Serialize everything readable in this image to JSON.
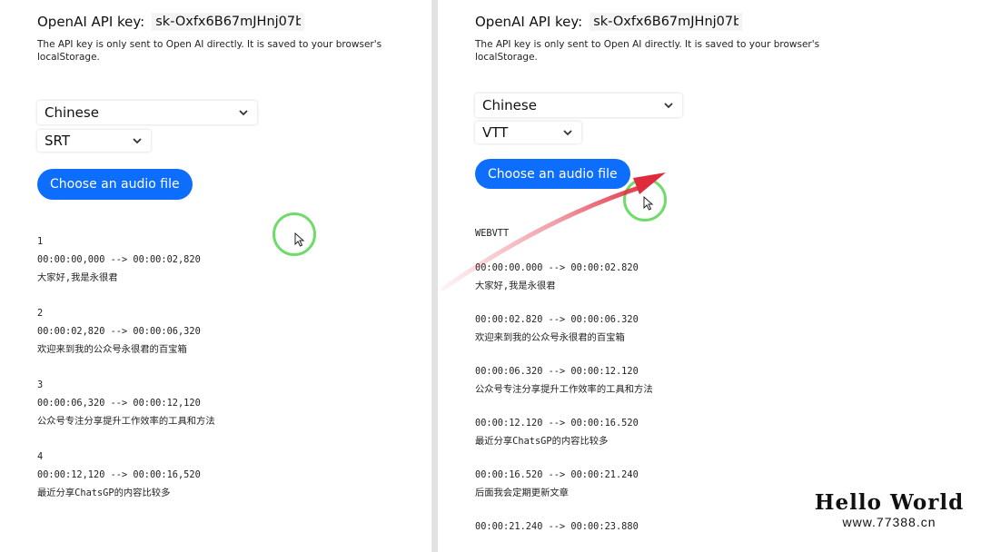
{
  "left": {
    "api_key_label": "OpenAI API key:",
    "api_key_value": "sk-Oxfx6B67mJHnj07bl",
    "notice": "The API key is only sent to Open AI directly. It is saved to your browser's localStorage.",
    "language_select": "Chinese",
    "format_select": "SRT",
    "choose_button": "Choose an audio file",
    "output": [
      {
        "index": "1",
        "timing": "00:00:00,000 --> 00:00:02,820",
        "text": "大家好,我是永很君"
      },
      {
        "index": "2",
        "timing": "00:00:02,820 --> 00:00:06,320",
        "text": "欢迎来到我的公众号永很君的百宝箱"
      },
      {
        "index": "3",
        "timing": "00:00:06,320 --> 00:00:12,120",
        "text": "公众号专注分享提升工作效率的工具和方法"
      },
      {
        "index": "4",
        "timing": "00:00:12,120 --> 00:00:16,520",
        "text": "最近分享ChatsGP的内容比较多"
      }
    ]
  },
  "right": {
    "api_key_label": "OpenAI API key:",
    "api_key_value": "sk-Oxfx6B67mJHnj07bl",
    "notice": "The API key is only sent to Open AI directly. It is saved to your browser's localStorage.",
    "language_select": "Chinese",
    "format_select": "VTT",
    "choose_button": "Choose an audio file",
    "output_header": "WEBVTT",
    "output": [
      {
        "timing": "00:00:00.000 --> 00:00:02.820",
        "text": "大家好,我是永很君"
      },
      {
        "timing": "00:00:02.820 --> 00:00:06.320",
        "text": "欢迎来到我的公众号永很君的百宝箱"
      },
      {
        "timing": "00:00:06.320 --> 00:00:12.120",
        "text": "公众号专注分享提升工作效率的工具和方法"
      },
      {
        "timing": "00:00:12.120 --> 00:00:16.520",
        "text": "最近分享ChatsGP的内容比较多"
      },
      {
        "timing": "00:00:16.520 --> 00:00:21.240",
        "text": "后面我会定期更新文章"
      },
      {
        "timing": "00:00:21.240 --> 00:00:23.880",
        "text": ""
      }
    ]
  },
  "icons": {
    "chevron": "chevron-down-icon",
    "cursor": "mouse-pointer-icon"
  },
  "colors": {
    "button_blue": "#0d6efd",
    "cursor_ring_green": "#6fdc6a",
    "annotation_arrow_red": "#e02b3c"
  },
  "watermark": {
    "title": "Hello World",
    "url": "www.77388.cn"
  }
}
